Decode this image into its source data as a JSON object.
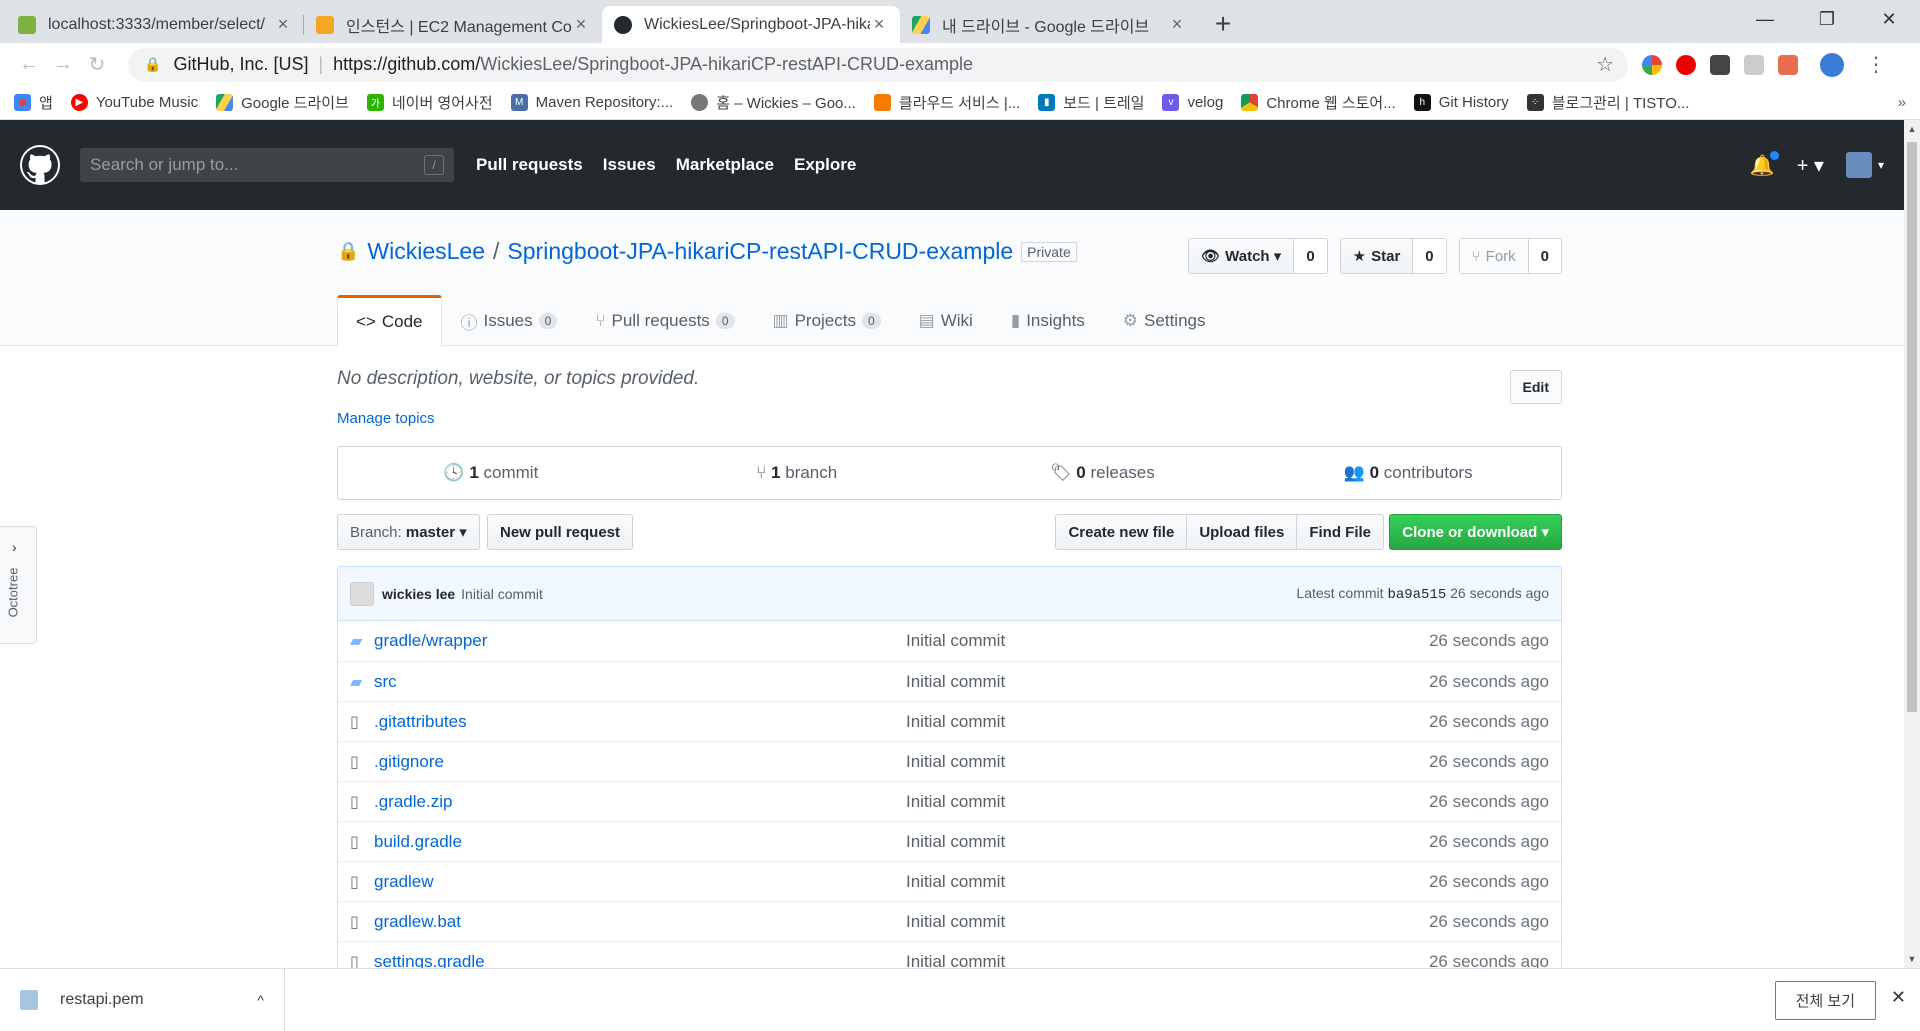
{
  "browser": {
    "tabs": [
      {
        "title": "localhost:3333/member/select/",
        "favicon_color": "#7cb342"
      },
      {
        "title": "인스턴스 | EC2 Management Co",
        "favicon_color": "#f5a623"
      },
      {
        "title": "WickiesLee/Springboot-JPA-hika",
        "favicon_color": "#24292e"
      },
      {
        "title": "내 드라이브 - Google 드라이브",
        "favicon_color": "#1fa463"
      }
    ],
    "omnibox": {
      "org": "GitHub, Inc. [US]",
      "url_prefix": "https://github.com/",
      "url_path": "WickiesLee/Springboot-JPA-hikariCP-restAPI-CRUD-example"
    },
    "bookmarks": [
      {
        "label": "앱",
        "color": "#e94235"
      },
      {
        "label": "YouTube Music",
        "color": "#ff0000"
      },
      {
        "label": "Google 드라이브",
        "color": "#1fa463"
      },
      {
        "label": "네이버 영어사전",
        "color": "#2db400"
      },
      {
        "label": "Maven Repository:...",
        "color": "#4a6fa5"
      },
      {
        "label": "홈 – Wickies – Goo...",
        "color": "#777777"
      },
      {
        "label": "클라우드 서비스 |...",
        "color": "#f57c00"
      },
      {
        "label": "보드 | 트레일",
        "color": "#0079bf"
      },
      {
        "label": "velog",
        "color": "#6c5ce7"
      },
      {
        "label": "Chrome 웹 스토어...",
        "color": "#db4437"
      },
      {
        "label": "Git History",
        "color": "#111111"
      },
      {
        "label": "블로그관리 | TISTO...",
        "color": "#333333"
      }
    ]
  },
  "github": {
    "search_placeholder": "Search or jump to...",
    "search_hotkey": "/",
    "nav": [
      "Pull requests",
      "Issues",
      "Marketplace",
      "Explore"
    ],
    "repo": {
      "owner": "WickiesLee",
      "name": "Springboot-JPA-hikariCP-restAPI-CRUD-example",
      "visibility": "Private",
      "watch_label": "Watch",
      "watch_count": "0",
      "star_label": "Star",
      "star_count": "0",
      "fork_label": "Fork",
      "fork_count": "0"
    },
    "tabs": [
      {
        "label": "Code",
        "icon": "<>",
        "count": ""
      },
      {
        "label": "Issues",
        "icon": "ⓘ",
        "count": "0"
      },
      {
        "label": "Pull requests",
        "icon": "⑂",
        "count": "0"
      },
      {
        "label": "Projects",
        "icon": "▥",
        "count": "0"
      },
      {
        "label": "Wiki",
        "icon": "▤",
        "count": ""
      },
      {
        "label": "Insights",
        "icon": "▮",
        "count": ""
      },
      {
        "label": "Settings",
        "icon": "⚙",
        "count": ""
      }
    ],
    "description": "No description, website, or topics provided.",
    "edit_label": "Edit",
    "manage_topics": "Manage topics",
    "summary": {
      "commits": {
        "num": "1",
        "label": "commit"
      },
      "branches": {
        "num": "1",
        "label": "branch"
      },
      "releases": {
        "num": "0",
        "label": "releases"
      },
      "contributors": {
        "num": "0",
        "label": "contributors"
      }
    },
    "filebar": {
      "branch_label": "Branch:",
      "branch_name": "master",
      "new_pr": "New pull request",
      "create_file": "Create new file",
      "upload": "Upload files",
      "find": "Find File",
      "clone": "Clone or download"
    },
    "commit_tease": {
      "author": "wickies lee",
      "message": "Initial commit",
      "latest_prefix": "Latest commit",
      "sha": "ba9a515",
      "age": "26 seconds ago"
    },
    "files": [
      {
        "name": "gradle/wrapper",
        "type": "dir",
        "message": "Initial commit",
        "age": "26 seconds ago"
      },
      {
        "name": "src",
        "type": "dir",
        "message": "Initial commit",
        "age": "26 seconds ago"
      },
      {
        "name": ".gitattributes",
        "type": "file",
        "message": "Initial commit",
        "age": "26 seconds ago"
      },
      {
        "name": ".gitignore",
        "type": "file",
        "message": "Initial commit",
        "age": "26 seconds ago"
      },
      {
        "name": ".gradle.zip",
        "type": "file",
        "message": "Initial commit",
        "age": "26 seconds ago"
      },
      {
        "name": "build.gradle",
        "type": "file",
        "message": "Initial commit",
        "age": "26 seconds ago"
      },
      {
        "name": "gradlew",
        "type": "file",
        "message": "Initial commit",
        "age": "26 seconds ago"
      },
      {
        "name": "gradlew.bat",
        "type": "file",
        "message": "Initial commit",
        "age": "26 seconds ago"
      },
      {
        "name": "settings.gradle",
        "type": "file",
        "message": "Initial commit",
        "age": "26 seconds ago"
      }
    ]
  },
  "octotree": {
    "label": "Octotree"
  },
  "download_shelf": {
    "file": "restapi.pem",
    "show_all": "전체 보기"
  }
}
